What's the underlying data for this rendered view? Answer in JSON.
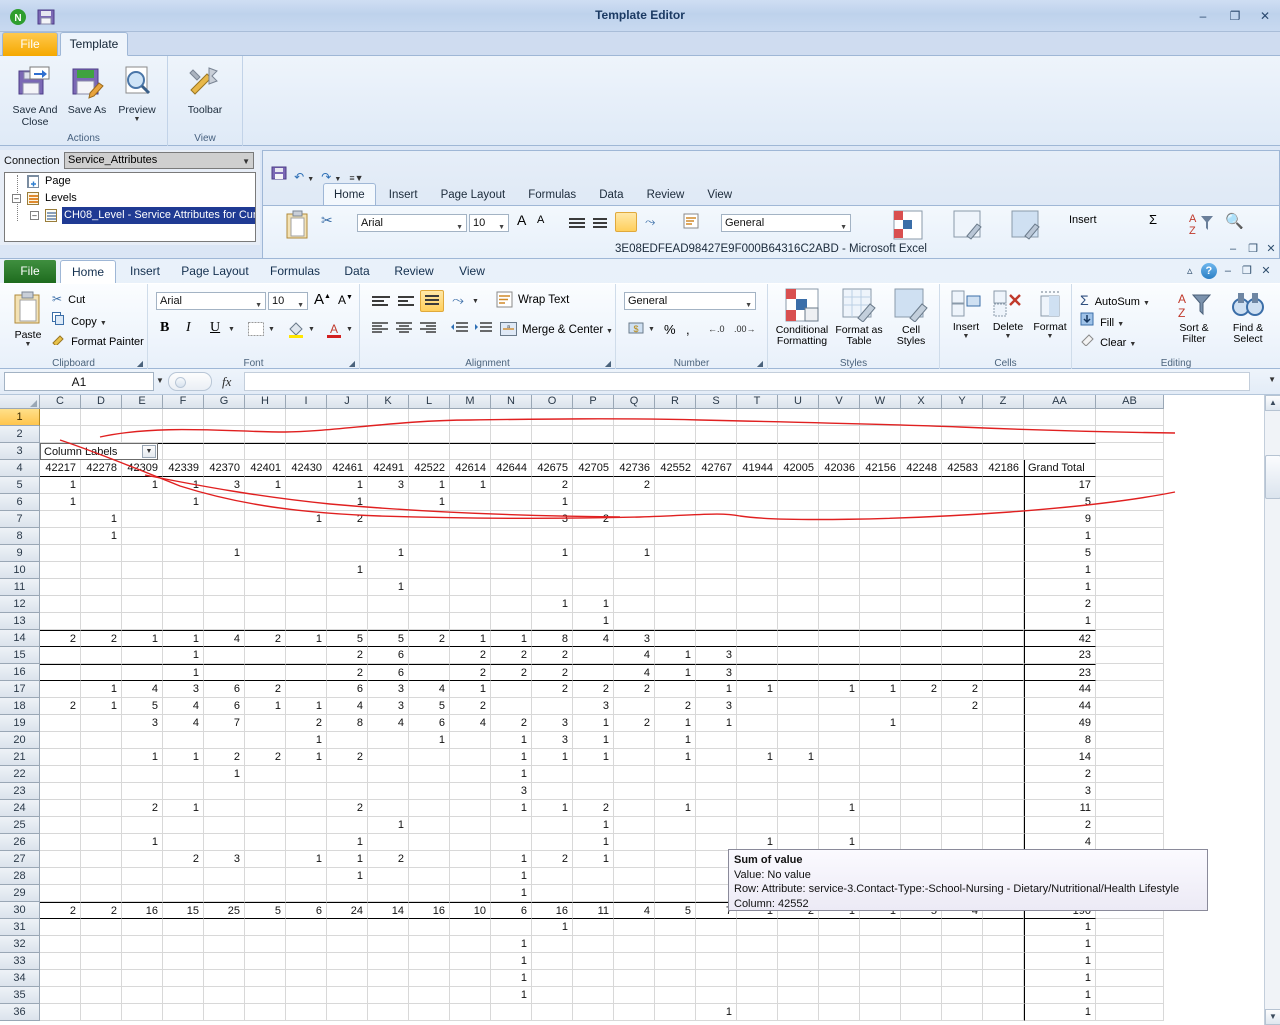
{
  "template_editor": {
    "title": "Template Editor",
    "window_buttons": [
      "minimize",
      "restore",
      "close"
    ],
    "quick_access": [
      "nitro-logo-icon",
      "save-icon"
    ],
    "tabs": [
      {
        "label": "File",
        "active": false
      },
      {
        "label": "Template",
        "active": true
      }
    ],
    "groups": [
      {
        "label": "Actions",
        "buttons": [
          {
            "label": "Save And Close",
            "icon": "save-and-close-icon"
          },
          {
            "label": "Save As",
            "icon": "save-as-icon"
          },
          {
            "label": "Preview",
            "icon": "preview-icon",
            "has_dropdown": true
          }
        ]
      },
      {
        "label": "View",
        "buttons": [
          {
            "label": "Toolbar",
            "icon": "toolbar-icon"
          }
        ]
      }
    ]
  },
  "connection_panel": {
    "label": "Connection",
    "selected_connection": "Service_Attributes",
    "tree": [
      {
        "label": "Page",
        "indent": 0,
        "icon": "page-add-icon",
        "expander": "",
        "selected": false
      },
      {
        "label": "Levels",
        "indent": 0,
        "icon": "levels-icon",
        "expander": "-",
        "selected": false
      },
      {
        "label": "CH08_Level - Service Attributes for Cur",
        "indent": 1,
        "icon": "level-icon",
        "expander": "-",
        "selected": true
      }
    ]
  },
  "background_excel": {
    "title": "3E08EDFEAD98427E9F000B64316C2ABD  -  Microsoft Excel",
    "tabs": [
      "Home",
      "Insert",
      "Page Layout",
      "Formulas",
      "Data",
      "Review",
      "View"
    ],
    "active_tab": "Home",
    "font_name": "Arial",
    "font_size": "10",
    "number_format": "General",
    "window_buttons": [
      "minimize",
      "restore",
      "close"
    ]
  },
  "excel": {
    "tabs": [
      {
        "label": "File",
        "active": false
      },
      {
        "label": "Home",
        "active": true
      },
      {
        "label": "Insert",
        "active": false
      },
      {
        "label": "Page Layout",
        "active": false
      },
      {
        "label": "Formulas",
        "active": false
      },
      {
        "label": "Data",
        "active": false
      },
      {
        "label": "Review",
        "active": false
      },
      {
        "label": "View",
        "active": false
      }
    ],
    "help_icon": "help-icon",
    "collapse_ribbon_icon": "chevron-up-icon",
    "window_buttons": [
      "minimize",
      "restore",
      "close"
    ],
    "groups": {
      "clipboard": {
        "label": "Clipboard",
        "paste": "Paste",
        "cut": "Cut",
        "copy": "Copy",
        "format_painter": "Format Painter"
      },
      "font": {
        "label": "Font",
        "font_name": "Arial",
        "font_size": "10",
        "grow_font": "A",
        "shrink_font": "A",
        "bold": "B",
        "italic": "I",
        "underline": "U"
      },
      "alignment": {
        "label": "Alignment",
        "wrap_text": "Wrap Text",
        "merge_center": "Merge & Center"
      },
      "number": {
        "label": "Number",
        "format": "General",
        "percent": "%",
        "comma": ","
      },
      "styles": {
        "label": "Styles",
        "conditional_formatting": "Conditional Formatting",
        "format_as_table": "Format as Table",
        "cell_styles": "Cell Styles"
      },
      "cells": {
        "label": "Cells",
        "insert": "Insert",
        "delete": "Delete",
        "format": "Format"
      },
      "editing": {
        "label": "Editing",
        "autosum": "AutoSum",
        "fill": "Fill",
        "clear": "Clear",
        "sort_filter": "Sort & Filter",
        "find_select": "Find & Select"
      }
    },
    "formula_bar": {
      "name_box": "A1",
      "formula": "",
      "fx_label": "fx"
    }
  },
  "sheet": {
    "column_headers": [
      "C",
      "D",
      "E",
      "F",
      "G",
      "H",
      "I",
      "J",
      "K",
      "L",
      "M",
      "N",
      "O",
      "P",
      "Q",
      "R",
      "S",
      "T",
      "U",
      "V",
      "W",
      "X",
      "Y",
      "Z",
      "AA",
      "AB"
    ],
    "row_numbers": [
      1,
      2,
      3,
      4,
      5,
      6,
      7,
      8,
      9,
      10,
      11,
      12,
      13,
      14,
      15,
      16,
      17,
      18,
      19,
      20,
      21,
      22,
      23,
      24,
      25,
      26,
      27,
      28,
      29,
      30,
      31,
      32,
      33,
      34,
      35,
      36
    ],
    "selected_cell": "A1",
    "pivot_filter_label": "Column Labels",
    "grand_total_label": "Grand Total",
    "date_headers": [
      "42217",
      "42278",
      "42309",
      "42339",
      "42370",
      "42401",
      "42430",
      "42461",
      "42491",
      "42522",
      "42614",
      "42644",
      "42675",
      "42705",
      "42736",
      "42552",
      "42767",
      "41944",
      "42005",
      "42036",
      "42156",
      "42248",
      "42583",
      "42186"
    ],
    "rows": [
      {
        "row": 5,
        "values": [
          "1",
          "",
          "1",
          "1",
          "3",
          "1",
          "",
          "1",
          "3",
          "1",
          "1",
          "",
          "2",
          "",
          "2",
          "",
          "",
          "",
          "",
          "",
          "",
          "",
          "",
          ""
        ],
        "grand_total": "17"
      },
      {
        "row": 6,
        "values": [
          "1",
          "",
          "",
          "1",
          "",
          "",
          "",
          "1",
          "",
          "1",
          "",
          "",
          "1",
          "",
          "",
          "",
          "",
          "",
          "",
          "",
          "",
          "",
          "",
          ""
        ],
        "grand_total": "5"
      },
      {
        "row": 7,
        "values": [
          "",
          "1",
          "",
          "",
          "",
          "",
          "1",
          "2",
          "",
          "",
          "",
          "",
          "3",
          "2",
          "",
          "",
          "",
          "",
          "",
          "",
          "",
          "",
          "",
          ""
        ],
        "grand_total": "9"
      },
      {
        "row": 8,
        "values": [
          "",
          "1",
          "",
          "",
          "",
          "",
          "",
          "",
          "",
          "",
          "",
          "",
          "",
          "",
          "",
          "",
          "",
          "",
          "",
          "",
          "",
          "",
          "",
          ""
        ],
        "grand_total": "1"
      },
      {
        "row": 9,
        "values": [
          "",
          "",
          "",
          "",
          "1",
          "",
          "",
          "",
          "1",
          "",
          "",
          "",
          "1",
          "",
          "1",
          "",
          "",
          "",
          "",
          "",
          "",
          "",
          "",
          ""
        ],
        "grand_total": "5"
      },
      {
        "row": 10,
        "values": [
          "",
          "",
          "",
          "",
          "",
          "",
          "",
          "1",
          "",
          "",
          "",
          "",
          "",
          "",
          "",
          "",
          "",
          "",
          "",
          "",
          "",
          "",
          "",
          ""
        ],
        "grand_total": "1"
      },
      {
        "row": 11,
        "values": [
          "",
          "",
          "",
          "",
          "",
          "",
          "",
          "",
          "1",
          "",
          "",
          "",
          "",
          "",
          "",
          "",
          "",
          "",
          "",
          "",
          "",
          "",
          "",
          ""
        ],
        "grand_total": "1"
      },
      {
        "row": 12,
        "values": [
          "",
          "",
          "",
          "",
          "",
          "",
          "",
          "",
          "",
          "",
          "",
          "",
          "1",
          "1",
          "",
          "",
          "",
          "",
          "",
          "",
          "",
          "",
          "",
          ""
        ],
        "grand_total": "2"
      },
      {
        "row": 13,
        "values": [
          "",
          "",
          "",
          "",
          "",
          "",
          "",
          "",
          "",
          "",
          "",
          "",
          "",
          "1",
          "",
          "",
          "",
          "",
          "",
          "",
          "",
          "",
          "",
          ""
        ],
        "grand_total": "1"
      },
      {
        "row": 14,
        "values": [
          "2",
          "2",
          "1",
          "1",
          "4",
          "2",
          "1",
          "5",
          "5",
          "2",
          "1",
          "1",
          "8",
          "4",
          "3",
          "",
          "",
          "",
          "",
          "",
          "",
          "",
          "",
          ""
        ],
        "grand_total": "42",
        "total_row": true
      },
      {
        "row": 15,
        "values": [
          "",
          "",
          "",
          "1",
          "",
          "",
          "",
          "2",
          "6",
          "",
          "2",
          "2",
          "2",
          "",
          "4",
          "1",
          "3",
          "",
          "",
          "",
          "",
          "",
          "",
          ""
        ],
        "grand_total": "23"
      },
      {
        "row": 16,
        "values": [
          "",
          "",
          "",
          "1",
          "",
          "",
          "",
          "2",
          "6",
          "",
          "2",
          "2",
          "2",
          "",
          "4",
          "1",
          "3",
          "",
          "",
          "",
          "",
          "",
          "",
          ""
        ],
        "grand_total": "23",
        "total_row": true
      },
      {
        "row": 17,
        "values": [
          "",
          "1",
          "4",
          "3",
          "6",
          "2",
          "",
          "6",
          "3",
          "4",
          "1",
          "",
          "2",
          "2",
          "2",
          "",
          "1",
          "1",
          "",
          "1",
          "1",
          "2",
          "2",
          ""
        ],
        "grand_total": "44"
      },
      {
        "row": 18,
        "values": [
          "2",
          "1",
          "5",
          "4",
          "6",
          "1",
          "1",
          "4",
          "3",
          "5",
          "2",
          "",
          "",
          "3",
          "",
          "2",
          "3",
          "",
          "",
          "",
          "",
          "",
          "2",
          ""
        ],
        "grand_total": "44"
      },
      {
        "row": 19,
        "values": [
          "",
          "",
          "3",
          "4",
          "7",
          "",
          "2",
          "8",
          "4",
          "6",
          "4",
          "2",
          "3",
          "1",
          "2",
          "1",
          "1",
          "",
          "",
          "",
          "1",
          "",
          "",
          ""
        ],
        "grand_total": "49"
      },
      {
        "row": 20,
        "values": [
          "",
          "",
          "",
          "",
          "",
          "",
          "1",
          "",
          "",
          "1",
          "",
          "1",
          "3",
          "1",
          "",
          "1",
          "",
          "",
          "",
          "",
          "",
          "",
          "",
          ""
        ],
        "grand_total": "8"
      },
      {
        "row": 21,
        "values": [
          "",
          "",
          "1",
          "1",
          "2",
          "2",
          "1",
          "2",
          "",
          "",
          "",
          "1",
          "1",
          "1",
          "",
          "1",
          "",
          "1",
          "1",
          "",
          "",
          "",
          "",
          ""
        ],
        "grand_total": "14"
      },
      {
        "row": 22,
        "values": [
          "",
          "",
          "",
          "",
          "1",
          "",
          "",
          "",
          "",
          "",
          "",
          "1",
          "",
          "",
          "",
          "",
          "",
          "",
          "",
          "",
          "",
          "",
          "",
          ""
        ],
        "grand_total": "2"
      },
      {
        "row": 23,
        "values": [
          "",
          "",
          "",
          "",
          "",
          "",
          "",
          "",
          "",
          "",
          "",
          "3",
          "",
          "",
          "",
          "",
          "",
          "",
          "",
          "",
          "",
          "",
          "",
          ""
        ],
        "grand_total": "3"
      },
      {
        "row": 24,
        "values": [
          "",
          "",
          "2",
          "1",
          "",
          "",
          "",
          "2",
          "",
          "",
          "",
          "1",
          "1",
          "2",
          "",
          "1",
          "",
          "",
          "",
          "1",
          "",
          "",
          "",
          ""
        ],
        "grand_total": "11"
      },
      {
        "row": 25,
        "values": [
          "",
          "",
          "",
          "",
          "",
          "",
          "",
          "",
          "1",
          "",
          "",
          "",
          "",
          "1",
          "",
          "",
          "",
          "",
          "",
          "",
          "",
          "",
          "",
          ""
        ],
        "grand_total": "2"
      },
      {
        "row": 26,
        "values": [
          "",
          "",
          "1",
          "",
          "",
          "",
          "",
          "1",
          "",
          "",
          "",
          "",
          "",
          "1",
          "",
          "",
          "",
          "1",
          "",
          "1",
          "",
          "",
          "",
          ""
        ],
        "grand_total": "4"
      },
      {
        "row": 27,
        "values": [
          "",
          "",
          "",
          "2",
          "3",
          "",
          "1",
          "1",
          "2",
          "",
          "",
          "1",
          "2",
          "1",
          "",
          "",
          "",
          "",
          "1",
          "",
          "1",
          "",
          "",
          ""
        ],
        "grand_total": ""
      },
      {
        "row": 28,
        "values": [
          "",
          "",
          "",
          "",
          "",
          "",
          "",
          "1",
          "",
          "",
          "",
          "1",
          "",
          "",
          "",
          "",
          "",
          "",
          "",
          "",
          "",
          "",
          "",
          ""
        ],
        "grand_total": ""
      },
      {
        "row": 29,
        "values": [
          "",
          "",
          "",
          "",
          "",
          "",
          "",
          "",
          "",
          "",
          "",
          "1",
          "",
          "",
          "",
          "",
          "",
          "",
          "",
          "",
          "",
          "",
          "",
          ""
        ],
        "grand_total": ""
      },
      {
        "row": 30,
        "values": [
          "2",
          "2",
          "16",
          "15",
          "25",
          "5",
          "6",
          "24",
          "14",
          "16",
          "10",
          "6",
          "16",
          "11",
          "4",
          "5",
          "7",
          "1",
          "2",
          "1",
          "1",
          "5",
          "4",
          ""
        ],
        "grand_total": "190",
        "total_row": true
      },
      {
        "row": 31,
        "values": [
          "",
          "",
          "",
          "",
          "",
          "",
          "",
          "",
          "",
          "",
          "",
          "",
          "1",
          "",
          "",
          "",
          "",
          "",
          "",
          "",
          "",
          "",
          "",
          ""
        ],
        "grand_total": "1"
      },
      {
        "row": 32,
        "values": [
          "",
          "",
          "",
          "",
          "",
          "",
          "",
          "",
          "",
          "",
          "",
          "1",
          "",
          "",
          "",
          "",
          "",
          "",
          "",
          "",
          "",
          "",
          "",
          ""
        ],
        "grand_total": "1"
      },
      {
        "row": 33,
        "values": [
          "",
          "",
          "",
          "",
          "",
          "",
          "",
          "",
          "",
          "",
          "",
          "1",
          "",
          "",
          "",
          "",
          "",
          "",
          "",
          "",
          "",
          "",
          "",
          ""
        ],
        "grand_total": "1"
      },
      {
        "row": 34,
        "values": [
          "",
          "",
          "",
          "",
          "",
          "",
          "",
          "",
          "",
          "",
          "",
          "1",
          "",
          "",
          "",
          "",
          "",
          "",
          "",
          "",
          "",
          "",
          "",
          ""
        ],
        "grand_total": "1"
      },
      {
        "row": 35,
        "values": [
          "",
          "",
          "",
          "",
          "",
          "",
          "",
          "",
          "",
          "",
          "",
          "1",
          "",
          "",
          "",
          "",
          "",
          "",
          "",
          "",
          "",
          "",
          "",
          ""
        ],
        "grand_total": "1"
      },
      {
        "row": 36,
        "values": [
          "",
          "",
          "",
          "",
          "",
          "",
          "",
          "",
          "",
          "",
          "",
          "",
          "",
          "",
          "",
          "",
          "1",
          "",
          "",
          "",
          "",
          "",
          "",
          ""
        ],
        "grand_total": "1"
      }
    ]
  },
  "tooltip": {
    "title": "Sum of value",
    "value_line": "Value: No value",
    "row_line": "Row: Attribute: service-3.Contact-Type:-School-Nursing - Dietary/Nutritional/Health Lifestyle",
    "column_line": "Column: 42552"
  },
  "colors": {
    "annotation_stroke": "#e02020",
    "selection_highlight": "#1f3a93",
    "file_tab_excel": "#1e6b1e",
    "file_tab_template": "#f5a800"
  }
}
